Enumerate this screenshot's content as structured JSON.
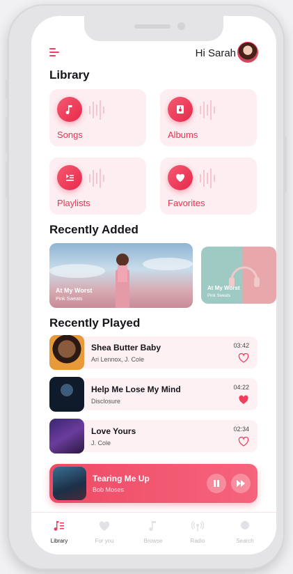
{
  "header": {
    "greeting": "Hi Sarah"
  },
  "library": {
    "title": "Library",
    "tiles": [
      {
        "label": "Songs",
        "icon": "music-note-icon"
      },
      {
        "label": "Albums",
        "icon": "album-icon"
      },
      {
        "label": "Playlists",
        "icon": "playlist-icon"
      },
      {
        "label": "Favorites",
        "icon": "heart-icon"
      }
    ]
  },
  "recently_added": {
    "title": "Recently Added",
    "items": [
      {
        "title": "At My Worst",
        "artist": "Pink Sweats"
      },
      {
        "title": "At My Worst",
        "artist": "Pink Sweats"
      }
    ]
  },
  "recently_played": {
    "title": "Recently Played",
    "items": [
      {
        "title": "Shea Butter Baby",
        "artist": "Ari Lennox, J. Cole",
        "duration": "03:42",
        "favorite": false
      },
      {
        "title": "Help Me Lose My Mind",
        "artist": "Disclosure",
        "duration": "04:22",
        "favorite": true
      },
      {
        "title": "Love Yours",
        "artist": "J. Cole",
        "duration": "02:34",
        "favorite": false
      }
    ]
  },
  "now_playing": {
    "title": "Tearing Me Up",
    "artist": "Bob Moses"
  },
  "nav": {
    "items": [
      {
        "label": "Library",
        "icon": "library-icon",
        "active": true
      },
      {
        "label": "For you",
        "icon": "heart-icon",
        "active": false
      },
      {
        "label": "Browse",
        "icon": "music-note-icon",
        "active": false
      },
      {
        "label": "Radio",
        "icon": "radio-icon",
        "active": false
      },
      {
        "label": "Search",
        "icon": "search-icon",
        "active": false
      }
    ]
  },
  "colors": {
    "accent": "#ef3f5c",
    "tile_bg": "#fdeef1"
  }
}
